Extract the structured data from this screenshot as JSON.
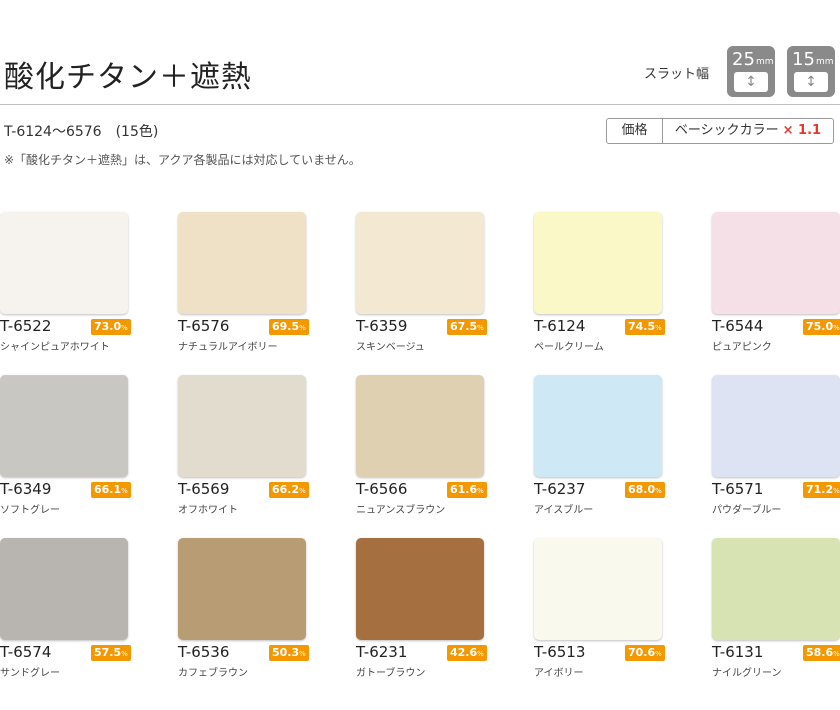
{
  "header": {
    "title": "酸化チタン＋遮熱",
    "slat_label": "スラット幅",
    "slat_widths": [
      {
        "value": "25",
        "unit": "mm",
        "icon": "vertical-arrow-icon"
      },
      {
        "value": "15",
        "unit": "mm",
        "icon": "vertical-arrow-icon"
      }
    ]
  },
  "info": {
    "range": "T-6124～6576　(15色)",
    "note": "※「酸化チタン＋遮熱」は、アクア各製品には対応していません。",
    "price_label": "価格",
    "price_value": "ベーシックカラー",
    "price_multiplier": "× 1.1"
  },
  "colors": [
    {
      "code": "T-6522",
      "percent": "73.0",
      "unit": "%",
      "name": "シャインピュアホワイト",
      "color": "#f6f3ee"
    },
    {
      "code": "T-6576",
      "percent": "69.5",
      "unit": "%",
      "name": "ナチュラルアイボリー",
      "color": "#efe1c6"
    },
    {
      "code": "T-6359",
      "percent": "67.5",
      "unit": "%",
      "name": "スキンベージュ",
      "color": "#f3e8d2"
    },
    {
      "code": "T-6124",
      "percent": "74.5",
      "unit": "%",
      "name": "ペールクリーム",
      "color": "#fbf8c8"
    },
    {
      "code": "T-6544",
      "percent": "75.0",
      "unit": "%",
      "name": "ピュアピンク",
      "color": "#f4e0e6"
    },
    {
      "code": "T-6349",
      "percent": "66.1",
      "unit": "%",
      "name": "ソフトグレー",
      "color": "#c9c7c2"
    },
    {
      "code": "T-6569",
      "percent": "66.2",
      "unit": "%",
      "name": "オフホワイト",
      "color": "#e1dcce"
    },
    {
      "code": "T-6566",
      "percent": "61.6",
      "unit": "%",
      "name": "ニュアンスブラウン",
      "color": "#dfd0b1"
    },
    {
      "code": "T-6237",
      "percent": "68.0",
      "unit": "%",
      "name": "アイスブルー",
      "color": "#cfe8f5"
    },
    {
      "code": "T-6571",
      "percent": "71.2",
      "unit": "%",
      "name": "パウダーブルー",
      "color": "#dde3f3"
    },
    {
      "code": "T-6574",
      "percent": "57.5",
      "unit": "%",
      "name": "サンドグレー",
      "color": "#b8b5b0"
    },
    {
      "code": "T-6536",
      "percent": "50.3",
      "unit": "%",
      "name": "カフェブラウン",
      "color": "#b89d74"
    },
    {
      "code": "T-6231",
      "percent": "42.6",
      "unit": "%",
      "name": "ガトーブラウン",
      "color": "#a66f40"
    },
    {
      "code": "T-6513",
      "percent": "70.6",
      "unit": "%",
      "name": "アイボリー",
      "color": "#f9f9ee"
    },
    {
      "code": "T-6131",
      "percent": "58.6",
      "unit": "%",
      "name": "ナイルグリーン",
      "color": "#d7e3b3"
    }
  ]
}
